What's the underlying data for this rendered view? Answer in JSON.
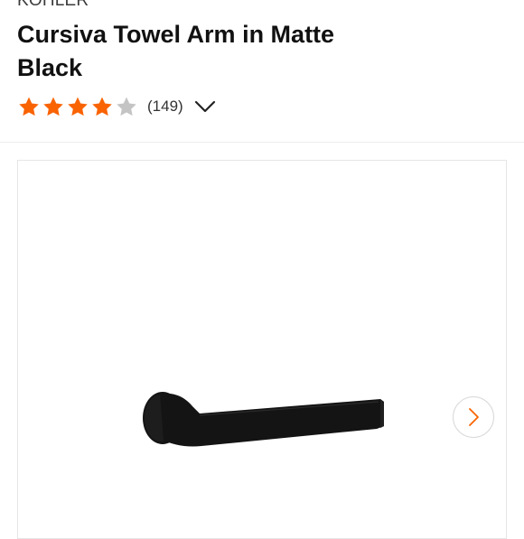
{
  "product": {
    "brand": "KOHLER",
    "title": "Cursiva Towel Arm in Matte Black"
  },
  "rating": {
    "value": 4,
    "max": 5,
    "count_text": "(149)",
    "star_color": "#f96302",
    "empty_star_color": "#c4c4c4"
  },
  "icons": {
    "expand": "chevron-down-icon",
    "next": "chevron-right-icon"
  },
  "colors": {
    "accent": "#f96302",
    "product": "#141414"
  }
}
